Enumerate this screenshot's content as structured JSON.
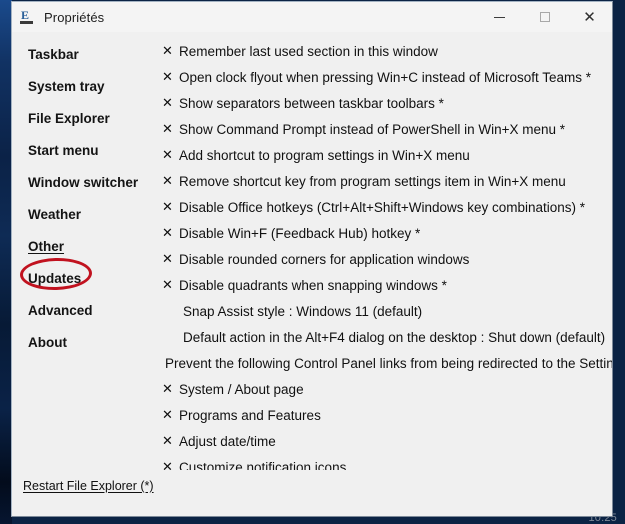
{
  "desktop": {
    "clock": "10:25"
  },
  "window": {
    "title": "Propriétés",
    "app_icon": "explorer-patcher-icon",
    "controls": {
      "minimize": "–",
      "maximize": "□",
      "close": "✕"
    }
  },
  "sidebar": {
    "items": [
      {
        "label": "Taskbar",
        "selected": false
      },
      {
        "label": "System tray",
        "selected": false
      },
      {
        "label": "File Explorer",
        "selected": false
      },
      {
        "label": "Start menu",
        "selected": false
      },
      {
        "label": "Window switcher",
        "selected": false
      },
      {
        "label": "Weather",
        "selected": false
      },
      {
        "label": "Other",
        "selected": true
      },
      {
        "label": "Updates",
        "selected": false
      },
      {
        "label": "Advanced",
        "selected": false
      },
      {
        "label": "About",
        "selected": false
      }
    ],
    "annotation_color": "#c1121f"
  },
  "content": {
    "rows": [
      {
        "type": "option",
        "mark": "✕",
        "label": "Remember last used section in this window"
      },
      {
        "type": "option",
        "mark": "✕",
        "label": "Open clock flyout when pressing Win+C instead of Microsoft Teams *"
      },
      {
        "type": "option",
        "mark": "✕",
        "label": "Show separators between taskbar toolbars *"
      },
      {
        "type": "option",
        "mark": "✕",
        "label": "Show Command Prompt instead of PowerShell in Win+X menu *"
      },
      {
        "type": "option",
        "mark": "✕",
        "label": "Add shortcut to program settings in Win+X menu"
      },
      {
        "type": "option",
        "mark": "✕",
        "label": "Remove shortcut key from program settings item in Win+X menu"
      },
      {
        "type": "option",
        "mark": "✕",
        "label": "Disable Office hotkeys (Ctrl+Alt+Shift+Windows key combinations) *"
      },
      {
        "type": "option",
        "mark": "✕",
        "label": "Disable Win+F (Feedback Hub) hotkey *"
      },
      {
        "type": "option",
        "mark": "✕",
        "label": "Disable rounded corners for application windows"
      },
      {
        "type": "option",
        "mark": "✕",
        "label": "Disable quadrants when snapping windows *"
      },
      {
        "type": "value",
        "label": "Snap Assist style : Windows 11 (default)"
      },
      {
        "type": "value",
        "label": "Default action in the Alt+F4 dialog on the desktop : Shut down (default)"
      },
      {
        "type": "note",
        "label": "Prevent the following Control Panel links from being redirected to the Settings app:"
      },
      {
        "type": "option",
        "mark": "✕",
        "label": "System / About page"
      },
      {
        "type": "option",
        "mark": "✕",
        "label": "Programs and Features"
      },
      {
        "type": "option",
        "mark": "✕",
        "label": "Adjust date/time"
      },
      {
        "type": "option",
        "mark": "✕",
        "label": "Customize notification icons"
      }
    ]
  },
  "footer": {
    "restart_link": "Restart File Explorer (*)"
  }
}
